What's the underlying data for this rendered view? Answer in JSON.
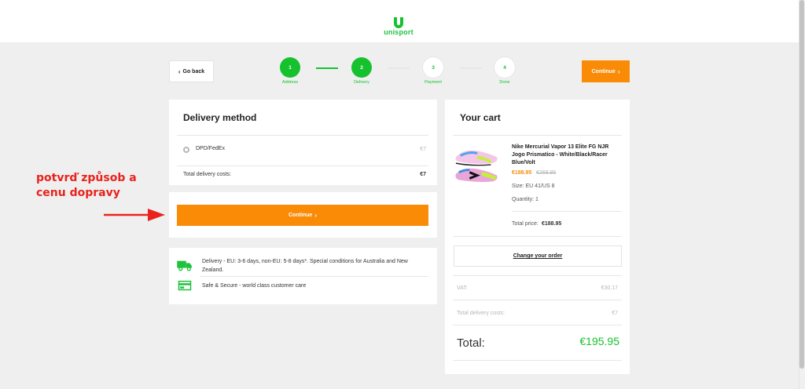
{
  "brand": {
    "name": "unisport",
    "accent": "#16c12e",
    "orange": "#f98b07"
  },
  "nav": {
    "go_back": "Go back",
    "continue": "Continue"
  },
  "steps": [
    {
      "number": "1",
      "label": "Address",
      "state": "done"
    },
    {
      "number": "2",
      "label": "Delivery",
      "state": "done"
    },
    {
      "number": "3",
      "label": "Payment",
      "state": "todo"
    },
    {
      "number": "4",
      "label": "Done",
      "state": "todo"
    }
  ],
  "delivery": {
    "title": "Delivery method",
    "option_label": "DPD/FedEx",
    "option_price": "€7",
    "total_label": "Total delivery costs:",
    "total_value": "€7",
    "continue_label": "Continue"
  },
  "info": [
    {
      "icon": "truck-icon",
      "text": "Delivery - EU: 3-6 days, non-EU: 5-8 days*. Special conditions for Australia and New Zealand."
    },
    {
      "icon": "secure-payment-icon",
      "text": "Safe & Secure - world class customer care"
    }
  ],
  "cart": {
    "title": "Your cart",
    "product_name": "Nike Mercurial Vapor 13 Elite FG NJR Jogo Prismatico - White/Black/Racer Blue/Volt",
    "price": "€188.95",
    "old_price": "€269.95",
    "size": "Size: EU 41/US 8",
    "quantity": "Quantity: 1",
    "total_price_label": "Total price:",
    "total_price_value": "€188.95",
    "change_order": "Change your order",
    "vat_label": "VAT:",
    "vat_value": "€30.17",
    "delivery_label": "Total delivery costs:",
    "delivery_value": "€7",
    "total_label": "Total:",
    "total_value": "€195.95"
  },
  "annotation": {
    "line1": "potvrď způsob a",
    "line2": "cenu dopravy",
    "color": "#e8231d"
  }
}
